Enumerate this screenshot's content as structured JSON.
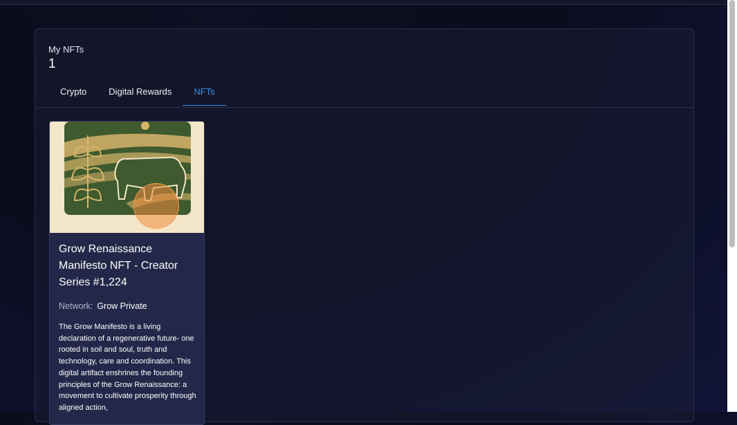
{
  "section": {
    "label": "My NFTs",
    "count": "1"
  },
  "tabs": [
    {
      "label": "Crypto"
    },
    {
      "label": "Digital Rewards"
    },
    {
      "label": "NFTs"
    }
  ],
  "active_tab": "NFTs",
  "nft": {
    "title": "Grow Renaissance Manifesto NFT - Creator Series #1,224",
    "network_label": "Network:",
    "network_value": "Grow Private",
    "description": "The Grow Manifesto is a living declaration of a regenerative future- one rooted in soil and soul, truth and technology, care and coordination. This digital artifact enshrines the founding principles of the Grow Renaissance: a movement to cultivate prosperity through aligned action,",
    "image_icon": "farm-landscape-illustration"
  },
  "colors": {
    "accent": "#3c8ee6",
    "card_bg": "#23284a",
    "image_bg": "#f3e6c9",
    "art_green": "#3e5a2e"
  }
}
